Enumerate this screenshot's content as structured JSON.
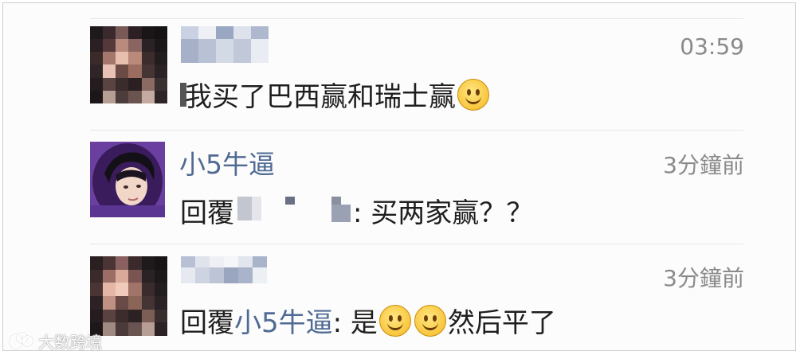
{
  "comments": [
    {
      "user_name": "",
      "time": "03:59",
      "text_visible": "我买了巴西赢和瑞士赢",
      "emojis": [
        "smile-emoji"
      ]
    },
    {
      "user_name": "小5牛逼",
      "time": "3分鐘前",
      "reply_prefix": "回覆",
      "reply_to_name": "",
      "text_after": ": 买两家赢？？"
    },
    {
      "user_name": "",
      "time": "3分鐘前",
      "reply_prefix": "回覆",
      "reply_to_name": "小5牛逼",
      "text_mid": ": 是",
      "text_end": "然后平了",
      "emojis": [
        "smile-emoji",
        "smile-emoji"
      ]
    }
  ],
  "watermark": {
    "text": "大数跨境"
  },
  "colors": {
    "username": "#4f6a93",
    "time": "#8a8a8a",
    "text": "#1e1e1e"
  }
}
